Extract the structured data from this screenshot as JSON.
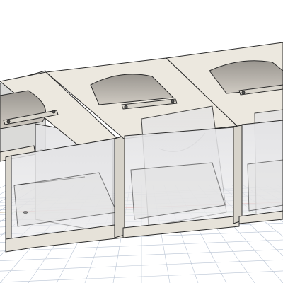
{
  "viewport": {
    "background": "#ffffff",
    "grid_color": "#b9c4d4",
    "axis_x_color": "#e06a6a",
    "axis_y_color": "#6ac46a"
  },
  "model": {
    "module_count": 3,
    "material_top": "#ece8df",
    "material_side": "#d9d5cc",
    "material_glass": "#e4e4e6",
    "edge_color": "#2b2b2b"
  }
}
